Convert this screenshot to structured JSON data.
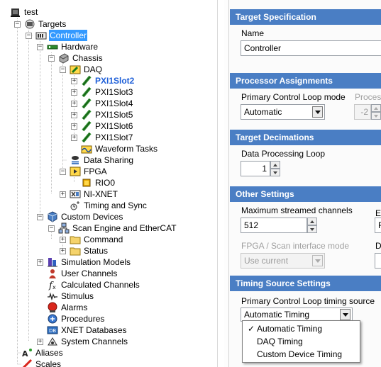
{
  "tree": {
    "items": [
      {
        "label": "test",
        "icon": "computer-icon"
      },
      {
        "label": "Targets",
        "icon": "targets-icon"
      },
      {
        "label": "Controller",
        "icon": "controller-icon",
        "selected": true
      },
      {
        "label": "Hardware",
        "icon": "hardware-icon"
      },
      {
        "label": "Chassis",
        "icon": "chassis-icon"
      },
      {
        "label": "DAQ",
        "icon": "daq-icon"
      },
      {
        "label": "PXI1Slot2",
        "icon": "daq-card-icon"
      },
      {
        "label": "PXI1Slot3",
        "icon": "daq-card-icon"
      },
      {
        "label": "PXI1Slot4",
        "icon": "daq-card-icon"
      },
      {
        "label": "PXI1Slot5",
        "icon": "daq-card-icon"
      },
      {
        "label": "PXI1Slot6",
        "icon": "daq-card-icon"
      },
      {
        "label": "PXI1Slot7",
        "icon": "daq-card-icon"
      },
      {
        "label": "Waveform Tasks",
        "icon": "waveform-tasks-icon"
      },
      {
        "label": "Data Sharing",
        "icon": "data-sharing-icon"
      },
      {
        "label": "FPGA",
        "icon": "fpga-icon"
      },
      {
        "label": "RIO0",
        "icon": "rio-icon"
      },
      {
        "label": "NI-XNET",
        "icon": "xnet-icon"
      },
      {
        "label": "Timing and Sync",
        "icon": "timing-sync-icon"
      },
      {
        "label": "Custom Devices",
        "icon": "custom-devices-icon"
      },
      {
        "label": "Scan Engine and EtherCAT",
        "icon": "scan-engine-icon"
      },
      {
        "label": "Command",
        "icon": "folder-icon"
      },
      {
        "label": "Status",
        "icon": "folder-icon"
      },
      {
        "label": "Simulation Models",
        "icon": "simulation-models-icon"
      },
      {
        "label": "User Channels",
        "icon": "user-channels-icon"
      },
      {
        "label": "Calculated Channels",
        "icon": "calculated-channels-icon"
      },
      {
        "label": "Stimulus",
        "icon": "stimulus-icon"
      },
      {
        "label": "Alarms",
        "icon": "alarms-icon"
      },
      {
        "label": "Procedures",
        "icon": "procedures-icon"
      },
      {
        "label": "XNET Databases",
        "icon": "xnet-databases-icon"
      },
      {
        "label": "System Channels",
        "icon": "system-channels-icon"
      },
      {
        "label": "Aliases",
        "icon": "aliases-icon"
      },
      {
        "label": "Scales",
        "icon": "scales-icon"
      }
    ]
  },
  "settings": {
    "target_spec": {
      "header": "Target Specification",
      "name_label": "Name",
      "name_value": "Controller"
    },
    "processor": {
      "header": "Processor Assignments",
      "pcl_mode_label": "Primary Control Loop mode",
      "pcl_mode_value": "Automatic",
      "processor_label": "Processo",
      "processor_value": "-2"
    },
    "decimations": {
      "header": "Target Decimations",
      "dpl_label": "Data Processing Loop",
      "dpl_value": "1"
    },
    "other": {
      "header": "Other Settings",
      "max_streamed_label": "Maximum streamed channels",
      "max_streamed_value": "512",
      "e_label": "E",
      "e_value": "F",
      "fpga_mode_label": "FPGA / Scan interface mode",
      "fpga_mode_value": "Use current",
      "d_label": "D"
    },
    "timing": {
      "header": "Timing Source Settings",
      "pcl_source_label": "Primary Control Loop timing source",
      "pcl_source_value": "Automatic Timing",
      "options": [
        "Automatic Timing",
        "DAQ Timing",
        "Custom Device Timing"
      ],
      "selected_option": "Automatic Timing",
      "check_mark": "✓"
    }
  },
  "colors": {
    "section_header": "#4a7ec4",
    "selection": "#3399ff",
    "selected_card_text": "#1e5fd8"
  }
}
